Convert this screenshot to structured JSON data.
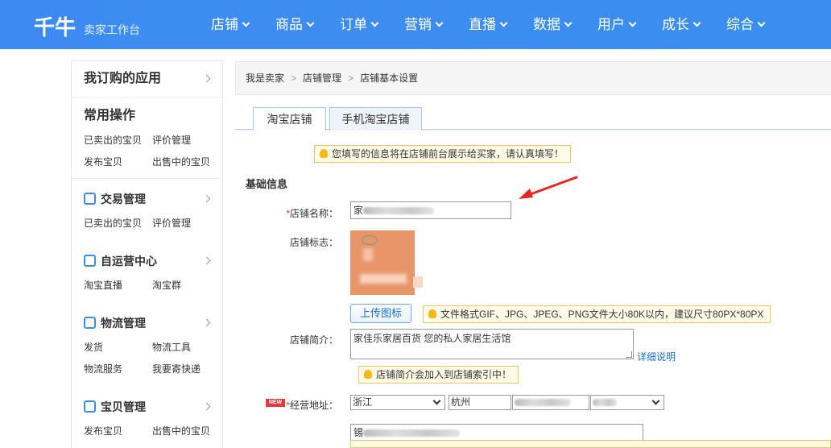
{
  "header": {
    "logo": "千牛",
    "subtitle": "卖家工作台",
    "nav": [
      {
        "label": "店铺"
      },
      {
        "label": "商品"
      },
      {
        "label": "订单"
      },
      {
        "label": "营销"
      },
      {
        "label": "直播"
      },
      {
        "label": "数据"
      },
      {
        "label": "用户"
      },
      {
        "label": "成长"
      },
      {
        "label": "综合"
      }
    ]
  },
  "sidebar": {
    "apps_title": "我订购的应用",
    "common_title": "常用操作",
    "common_links": [
      "已卖出的宝贝",
      "评价管理",
      "发布宝贝",
      "出售中的宝贝"
    ],
    "groups": [
      {
        "title": "交易管理",
        "icon": "clipboard-icon",
        "links": [
          "已卖出的宝贝",
          "评价管理"
        ]
      },
      {
        "title": "自运营中心",
        "icon": "chat-icon",
        "links": [
          "淘宝直播",
          "淘宝群"
        ]
      },
      {
        "title": "物流管理",
        "icon": "book-icon",
        "links": [
          "发货",
          "物流工具",
          "物流服务",
          "我要寄快递"
        ]
      },
      {
        "title": "宝贝管理",
        "icon": "bag-icon",
        "links": [
          "发布宝贝",
          "出售中的宝贝"
        ]
      }
    ]
  },
  "breadcrumb": [
    "我是卖家",
    "店铺管理",
    "店铺基本设置"
  ],
  "breadcrumb_sep": ">",
  "tabs": [
    "淘宝店铺",
    "手机淘宝店铺"
  ],
  "form": {
    "notice": "您填写的信息将在店铺前台展示给买家，请认真填写！",
    "section_title": "基础信息",
    "required_mark": "*",
    "name_label": "店铺名称：",
    "name_value_prefix": "家",
    "logo_label": "店铺标志：",
    "upload_label": "上传图标",
    "upload_tip": "文件格式GIF、JPG、JPEG、PNG文件大小80K以内，建议尺寸80PX*80PX",
    "intro_label": "店铺简介：",
    "intro_value": "家佳乐家居百货 您的私人家居生活馆",
    "detail_link": "详细说明",
    "intro_tip": "店铺简介会加入到店铺索引中！",
    "new_badge": "NEW",
    "address_label": "经营地址：",
    "province": "浙江",
    "city": "杭州",
    "address_prefix": "锡"
  },
  "colors": {
    "header_bg": "#3a8ef0",
    "accent": "#1a6fcf",
    "required": "#e4393c",
    "tip_bg": "#fffbe6",
    "tip_border": "#f0c36d",
    "annotation_arrow": "#e8281f"
  }
}
